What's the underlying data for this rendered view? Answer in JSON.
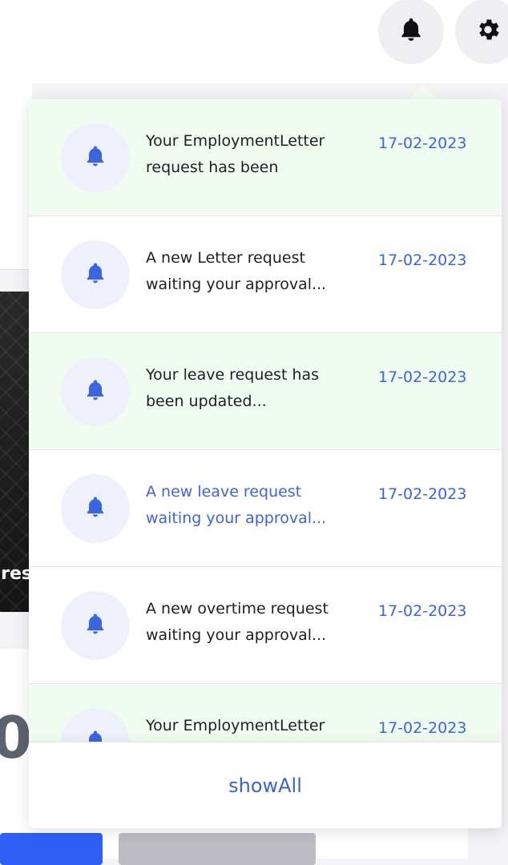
{
  "header": {
    "notification_icon": "bell-icon",
    "settings_icon": "gear-icon"
  },
  "background": {
    "image_caption_fragment": "ures",
    "big_number_fragment": "0"
  },
  "notifications": {
    "icon": "bell-icon",
    "accent_color": "#3b64e0",
    "unread_background": "#f1fcf0",
    "items": [
      {
        "message": "Your EmploymentLetter request has been updated...",
        "date": "17-02-2023",
        "unread": true,
        "highlight": false
      },
      {
        "message": "A new Letter request waiting your approval...",
        "date": "17-02-2023",
        "unread": false,
        "highlight": false
      },
      {
        "message": "Your leave request has been updated...",
        "date": "17-02-2023",
        "unread": true,
        "highlight": false
      },
      {
        "message": "A new leave request waiting your approval...",
        "date": "17-02-2023",
        "unread": false,
        "highlight": true
      },
      {
        "message": "A new overtime request waiting your approval...",
        "date": "17-02-2023",
        "unread": false,
        "highlight": false
      },
      {
        "message": "Your EmploymentLetter request has been updated...",
        "date": "17-02-2023",
        "unread": true,
        "highlight": false
      }
    ],
    "show_all_label": "showAll"
  }
}
